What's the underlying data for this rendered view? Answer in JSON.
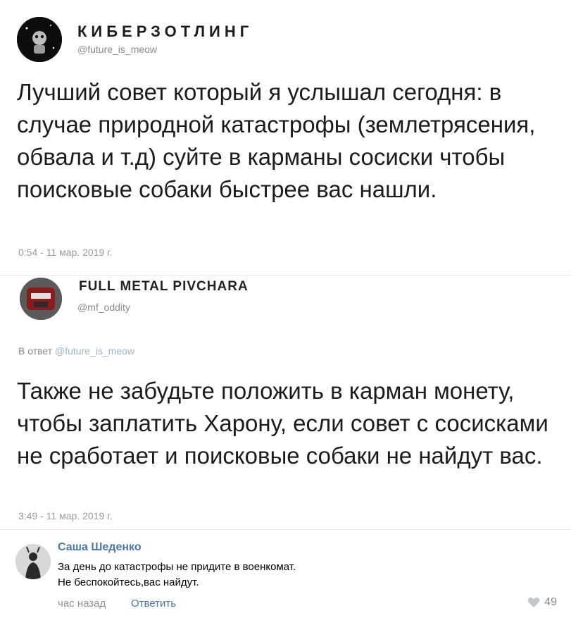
{
  "tweet1": {
    "author": "КИБЕРЗОТЛИНГ",
    "handle": "@future_is_meow",
    "text": "Лучший совет который я услышал сегодня: в случае природной катастрофы (землетрясения, обвала и т.д) суйте в карманы сосиски чтобы поисковые собаки быстрее вас нашли.",
    "timestamp": "0:54 - 11 мар. 2019 г."
  },
  "tweet2": {
    "author": "FULL METAL PIVCHARA",
    "handle": "@mf_oddity",
    "reply_prefix": "В ответ",
    "reply_handle": "@future_is_meow",
    "text": "Также не забудьте положить в карман монету, чтобы заплатить Харону, если совет с сосисками не сработает и поисковые собаки не найдут вас.",
    "timestamp": "3:49 - 11 мар. 2019 г."
  },
  "comment": {
    "author": "Саша Шеденко",
    "text_line1": "За день до катастрофы не придите в военкомат.",
    "text_line2": "Не беспокойтесь,вас найдут.",
    "time": "час назад",
    "reply_label": "Ответить",
    "likes": "49",
    "like_icon": "heart-icon"
  },
  "colors": {
    "link_blue": "#4a76a8",
    "muted_gray": "#8a8a8a",
    "divider": "#e6e6e6"
  }
}
